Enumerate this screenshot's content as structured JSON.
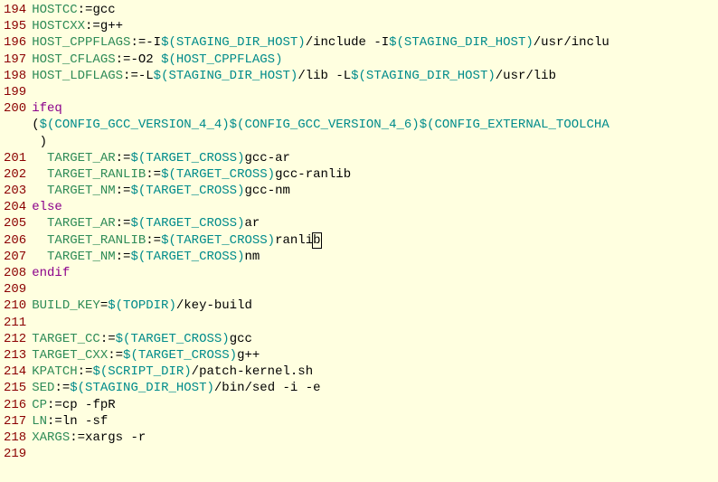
{
  "code": {
    "line_start": 194,
    "lines": [
      {
        "n": 194,
        "segs": [
          {
            "c": "ident",
            "t": "HOSTCC"
          },
          {
            "c": "op",
            "t": ":="
          },
          {
            "c": "plain",
            "t": "gcc"
          }
        ]
      },
      {
        "n": 195,
        "segs": [
          {
            "c": "ident",
            "t": "HOSTCXX"
          },
          {
            "c": "op",
            "t": ":="
          },
          {
            "c": "plain",
            "t": "g++"
          }
        ]
      },
      {
        "n": 196,
        "segs": [
          {
            "c": "ident",
            "t": "HOST_CPPFLAGS"
          },
          {
            "c": "op",
            "t": ":="
          },
          {
            "c": "plain",
            "t": "-I"
          },
          {
            "c": "var",
            "t": "$(STAGING_DIR_HOST)"
          },
          {
            "c": "plain",
            "t": "/include -I"
          },
          {
            "c": "var",
            "t": "$(STAGING_DIR_HOST)"
          },
          {
            "c": "plain",
            "t": "/usr/inclu"
          }
        ]
      },
      {
        "n": 197,
        "segs": [
          {
            "c": "ident",
            "t": "HOST_CFLAGS"
          },
          {
            "c": "op",
            "t": ":="
          },
          {
            "c": "plain",
            "t": "-O2 "
          },
          {
            "c": "var",
            "t": "$(HOST_CPPFLAGS)"
          }
        ]
      },
      {
        "n": 198,
        "segs": [
          {
            "c": "ident",
            "t": "HOST_LDFLAGS"
          },
          {
            "c": "op",
            "t": ":="
          },
          {
            "c": "plain",
            "t": "-L"
          },
          {
            "c": "var",
            "t": "$(STAGING_DIR_HOST)"
          },
          {
            "c": "plain",
            "t": "/lib -L"
          },
          {
            "c": "var",
            "t": "$(STAGING_DIR_HOST)"
          },
          {
            "c": "plain",
            "t": "/usr/lib"
          }
        ]
      },
      {
        "n": 199,
        "segs": []
      },
      {
        "n": 200,
        "segs": [
          {
            "c": "kw",
            "t": "ifeq"
          }
        ]
      },
      {
        "n": "   ",
        "segs": [
          {
            "c": "plain",
            "t": "("
          },
          {
            "c": "var",
            "t": "$(CONFIG_GCC_VERSION_4_4)$(CONFIG_GCC_VERSION_4_6)$(CONFIG_EXTERNAL_TOOLCHA"
          }
        ]
      },
      {
        "n": "   ",
        "segs": [
          {
            "c": "plain",
            "t": " )"
          }
        ]
      },
      {
        "n": 201,
        "segs": [
          {
            "c": "plain",
            "t": "  "
          },
          {
            "c": "ident",
            "t": "TARGET_AR"
          },
          {
            "c": "op",
            "t": ":="
          },
          {
            "c": "var",
            "t": "$(TARGET_CROSS)"
          },
          {
            "c": "plain",
            "t": "gcc-ar"
          }
        ]
      },
      {
        "n": 202,
        "segs": [
          {
            "c": "plain",
            "t": "  "
          },
          {
            "c": "ident",
            "t": "TARGET_RANLIB"
          },
          {
            "c": "op",
            "t": ":="
          },
          {
            "c": "var",
            "t": "$(TARGET_CROSS)"
          },
          {
            "c": "plain",
            "t": "gcc-ranlib"
          }
        ]
      },
      {
        "n": 203,
        "segs": [
          {
            "c": "plain",
            "t": "  "
          },
          {
            "c": "ident",
            "t": "TARGET_NM"
          },
          {
            "c": "op",
            "t": ":="
          },
          {
            "c": "var",
            "t": "$(TARGET_CROSS)"
          },
          {
            "c": "plain",
            "t": "gcc-nm"
          }
        ]
      },
      {
        "n": 204,
        "segs": [
          {
            "c": "kw",
            "t": "else"
          }
        ]
      },
      {
        "n": 205,
        "segs": [
          {
            "c": "plain",
            "t": "  "
          },
          {
            "c": "ident",
            "t": "TARGET_AR"
          },
          {
            "c": "op",
            "t": ":="
          },
          {
            "c": "var",
            "t": "$(TARGET_CROSS)"
          },
          {
            "c": "plain",
            "t": "ar"
          }
        ]
      },
      {
        "n": 206,
        "segs": [
          {
            "c": "plain",
            "t": "  "
          },
          {
            "c": "ident",
            "t": "TARGET_RANLIB"
          },
          {
            "c": "op",
            "t": ":="
          },
          {
            "c": "var",
            "t": "$(TARGET_CROSS)"
          },
          {
            "c": "plain",
            "t": "ranli"
          },
          {
            "c": "plain cursor-box",
            "t": "b"
          }
        ]
      },
      {
        "n": 207,
        "segs": [
          {
            "c": "plain",
            "t": "  "
          },
          {
            "c": "ident",
            "t": "TARGET_NM"
          },
          {
            "c": "op",
            "t": ":="
          },
          {
            "c": "var",
            "t": "$(TARGET_CROSS)"
          },
          {
            "c": "plain",
            "t": "nm"
          }
        ]
      },
      {
        "n": 208,
        "segs": [
          {
            "c": "kw",
            "t": "endif"
          }
        ]
      },
      {
        "n": 209,
        "segs": []
      },
      {
        "n": 210,
        "segs": [
          {
            "c": "ident",
            "t": "BUILD_KEY"
          },
          {
            "c": "op",
            "t": "="
          },
          {
            "c": "var",
            "t": "$(TOPDIR)"
          },
          {
            "c": "plain",
            "t": "/key-build"
          }
        ]
      },
      {
        "n": 211,
        "segs": []
      },
      {
        "n": 212,
        "segs": [
          {
            "c": "ident",
            "t": "TARGET_CC"
          },
          {
            "c": "op",
            "t": ":="
          },
          {
            "c": "var",
            "t": "$(TARGET_CROSS)"
          },
          {
            "c": "plain",
            "t": "gcc"
          }
        ]
      },
      {
        "n": 213,
        "segs": [
          {
            "c": "ident",
            "t": "TARGET_CXX"
          },
          {
            "c": "op",
            "t": ":="
          },
          {
            "c": "var",
            "t": "$(TARGET_CROSS)"
          },
          {
            "c": "plain",
            "t": "g++"
          }
        ]
      },
      {
        "n": 214,
        "segs": [
          {
            "c": "ident",
            "t": "KPATCH"
          },
          {
            "c": "op",
            "t": ":="
          },
          {
            "c": "var",
            "t": "$(SCRIPT_DIR)"
          },
          {
            "c": "plain",
            "t": "/patch-kernel.sh"
          }
        ]
      },
      {
        "n": 215,
        "segs": [
          {
            "c": "ident",
            "t": "SED"
          },
          {
            "c": "op",
            "t": ":="
          },
          {
            "c": "var",
            "t": "$(STAGING_DIR_HOST)"
          },
          {
            "c": "plain",
            "t": "/bin/sed -i -e"
          }
        ]
      },
      {
        "n": 216,
        "segs": [
          {
            "c": "ident",
            "t": "CP"
          },
          {
            "c": "op",
            "t": ":="
          },
          {
            "c": "plain",
            "t": "cp -fpR"
          }
        ]
      },
      {
        "n": 217,
        "segs": [
          {
            "c": "ident",
            "t": "LN"
          },
          {
            "c": "op",
            "t": ":="
          },
          {
            "c": "plain",
            "t": "ln -sf"
          }
        ]
      },
      {
        "n": 218,
        "segs": [
          {
            "c": "ident",
            "t": "XARGS"
          },
          {
            "c": "op",
            "t": ":="
          },
          {
            "c": "plain",
            "t": "xargs -r"
          }
        ]
      },
      {
        "n": 219,
        "segs": []
      }
    ]
  }
}
